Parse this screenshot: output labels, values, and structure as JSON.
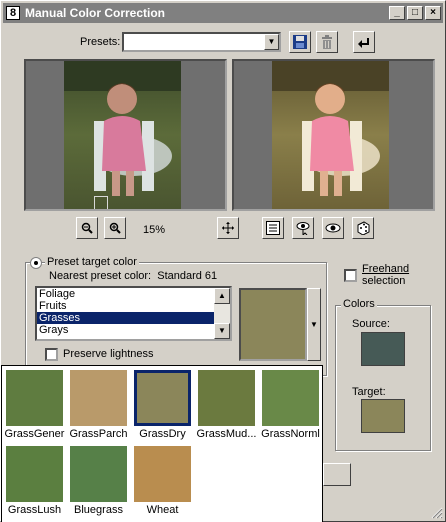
{
  "window": {
    "title": "Manual Color Correction",
    "icon_text": "8",
    "controls": [
      "_",
      "□",
      "×"
    ]
  },
  "presets": {
    "label": "Presets:",
    "value": ""
  },
  "toolbar_icons": [
    "save-icon",
    "delete-icon",
    "reset-icon"
  ],
  "zoom": {
    "level": "15%"
  },
  "preset_target": {
    "option_label": "Preset target color",
    "nearest_label": "Nearest preset color:",
    "nearest_value": "Standard 61",
    "categories": [
      "Foliage",
      "Fruits",
      "Grasses",
      "Grays"
    ],
    "selected_category": "Grasses",
    "preserve_lightness_label": "Preserve lightness",
    "current_color": "#8b865a"
  },
  "freehand": {
    "label_line1": "Freehand",
    "label_line2": "selection"
  },
  "colors_panel": {
    "title": "Colors",
    "source_label": "Source:",
    "source_color": "#465a56",
    "target_label": "Target:",
    "target_color": "#8b865a"
  },
  "swatches": [
    {
      "name": "GrassGener",
      "color": "#5f7c40",
      "selected": false
    },
    {
      "name": "GrassParch",
      "color": "#b99a6a",
      "selected": false
    },
    {
      "name": "GrassDry",
      "color": "#8b865a",
      "selected": true
    },
    {
      "name": "GrassMud...",
      "color": "#6b7a3f",
      "selected": false
    },
    {
      "name": "GrassNorml",
      "color": "#698948",
      "selected": false
    },
    {
      "name": "GrassLush",
      "color": "#5b7f40",
      "selected": false
    },
    {
      "name": "Bluegrass",
      "color": "#568048",
      "selected": false
    },
    {
      "name": "Wheat",
      "color": "#b98d4f",
      "selected": false
    }
  ]
}
